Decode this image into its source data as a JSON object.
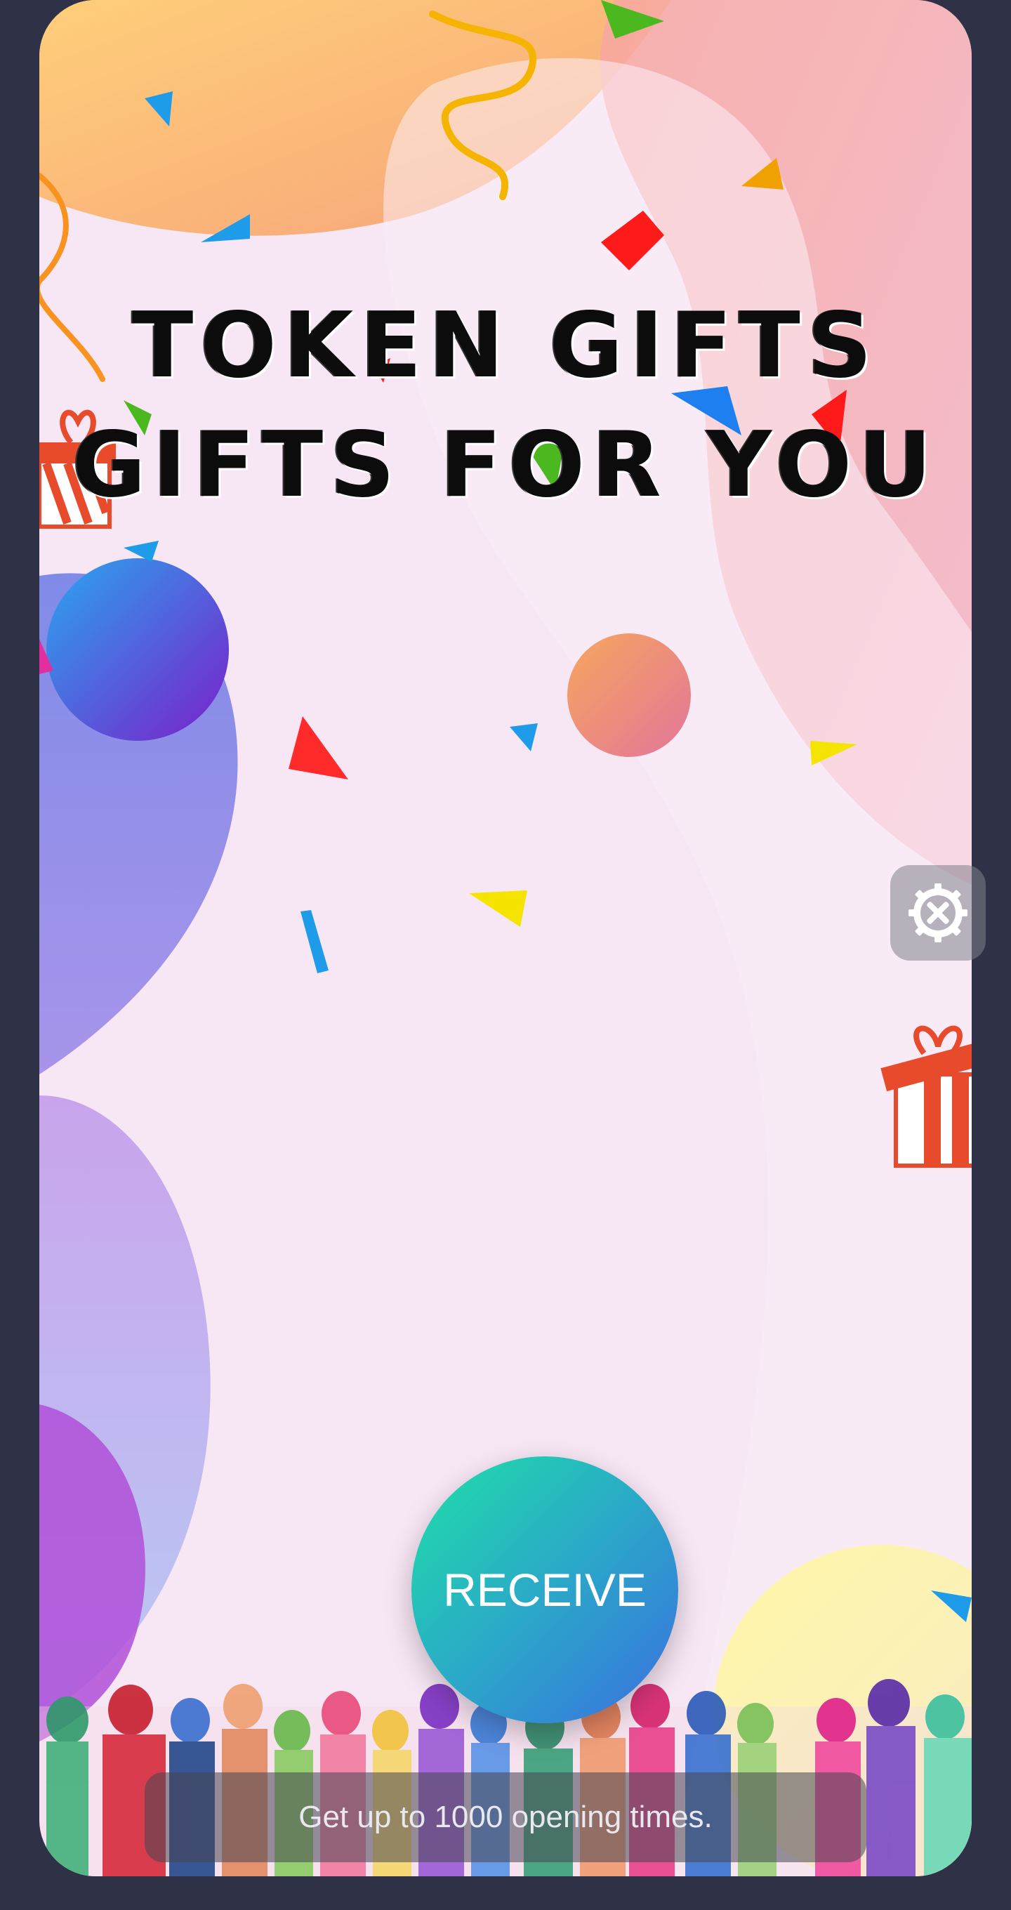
{
  "header": {
    "title_line1": "TOKEN GIFTS",
    "title_line2": "GIFTS FOR YOU"
  },
  "actions": {
    "receive_label": "RECEIVE"
  },
  "footer": {
    "info_text": "Get up to 1000 opening times."
  },
  "icons": {
    "settings": "settings-tools-icon",
    "gift_left": "gift-box-icon",
    "gift_right": "gift-box-icon"
  },
  "colors": {
    "background": "#2f3246",
    "card": "#f7e6f4",
    "receive_gradient_start": "#1fe0a6",
    "receive_gradient_end": "#3b6fe0",
    "title": "#0c0c0c"
  }
}
